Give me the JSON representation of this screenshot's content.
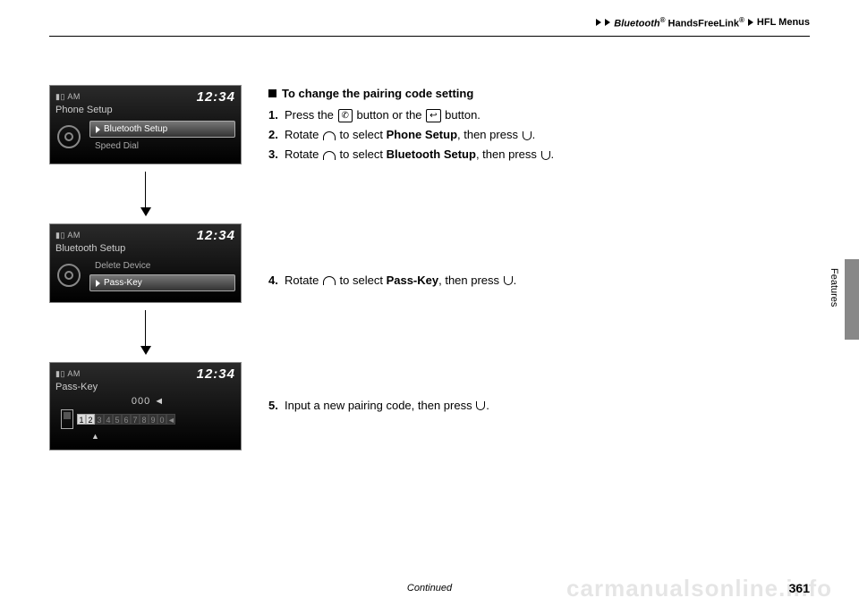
{
  "breadcrumb": {
    "a": "Bluetooth",
    "a_sup": "®",
    "b": "HandsFreeLink",
    "b_sup": "®",
    "c": "HFL Menus"
  },
  "screens": {
    "s1": {
      "signal": "▮▯ AM",
      "clock": "12:34",
      "title": "Phone Setup",
      "row_sel": "Bluetooth Setup",
      "row2": "Speed Dial"
    },
    "s2": {
      "signal": "▮▯ AM",
      "clock": "12:34",
      "title": "Bluetooth Setup",
      "row1": "Delete Device",
      "row_sel": "Pass-Key"
    },
    "s3": {
      "signal": "▮▯ AM",
      "clock": "12:34",
      "title": "Pass-Key",
      "code": "000 ◄",
      "d1": "1",
      "d2": "2",
      "d3": "3",
      "d4": "4",
      "d5": "5",
      "d6": "6",
      "d7": "7",
      "d8": "8",
      "d9": "9",
      "d0": "0",
      "caret": "▲"
    }
  },
  "text": {
    "heading": "To change the pairing code setting",
    "s1_num": "1.",
    "s1_a": "Press the ",
    "s1_icon1": "✆",
    "s1_b": " button or the ",
    "s1_icon2": "↩",
    "s1_c": " button.",
    "s2_num": "2.",
    "s2_a": "Rotate ",
    "s2_b": " to select ",
    "s2_bold": "Phone Setup",
    "s2_c": ", then press ",
    "s2_d": ".",
    "s3_num": "3.",
    "s3_a": "Rotate ",
    "s3_b": " to select ",
    "s3_bold": "Bluetooth Setup",
    "s3_c": ", then press ",
    "s3_d": ".",
    "s4_num": "4.",
    "s4_a": "Rotate ",
    "s4_b": " to select ",
    "s4_bold": "Pass-Key",
    "s4_c": ", then press ",
    "s4_d": ".",
    "s5_num": "5.",
    "s5_a": "Input a new pairing code, then press ",
    "s5_b": "."
  },
  "footer": "Continued",
  "page_num": "361",
  "side_label": "Features",
  "watermark": "carmanualsonline.info"
}
